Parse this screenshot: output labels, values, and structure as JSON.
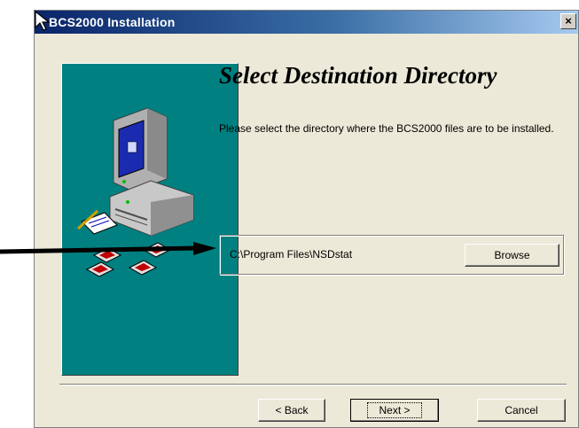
{
  "window": {
    "title": "BCS2000 Installation",
    "close_glyph": "×"
  },
  "page": {
    "heading": "Select Destination Directory",
    "description": "Please select the directory where the BCS2000 files are to be installed."
  },
  "destination": {
    "path": "C:\\Program Files\\NSDstat",
    "browse_label": "Browse"
  },
  "buttons": {
    "back_label": "< Back",
    "next_label": "Next >",
    "cancel_label": "Cancel"
  },
  "colors": {
    "side_panel": "#008080",
    "titlebar": "#0a246a",
    "dialog": "#ece9d8"
  }
}
